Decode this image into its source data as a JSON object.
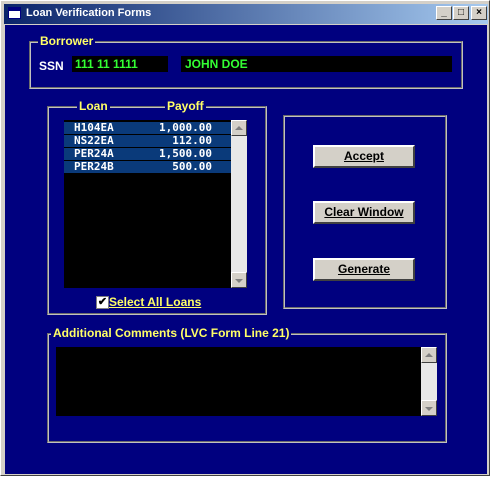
{
  "window": {
    "title": "Loan Verification Forms"
  },
  "borrower": {
    "legend": "Borrower",
    "ssn_label": "SSN",
    "ssn_value": "111 11 1111",
    "name": "JOHN DOE"
  },
  "loans": {
    "legend_loan": "Loan",
    "legend_payoff": "Payoff",
    "rows": [
      {
        "loan": "H104EA",
        "payoff": "1,000.00"
      },
      {
        "loan": "NS22EA",
        "payoff": "112.00"
      },
      {
        "loan": "PER24A",
        "payoff": "1,500.00"
      },
      {
        "loan": "PER24B",
        "payoff": "500.00"
      }
    ],
    "select_all_label": "Select All Loans",
    "select_all_checked": true
  },
  "actions": {
    "accept_label": "Accept",
    "clear_label": "Clear Window",
    "generate_label": "Generate"
  },
  "comments": {
    "legend": "Additional Comments (LVC Form Line 21)",
    "value": ""
  },
  "colors": {
    "background": "#00007f",
    "legend_text": "#ffff66",
    "field_text": "#33ff33"
  }
}
